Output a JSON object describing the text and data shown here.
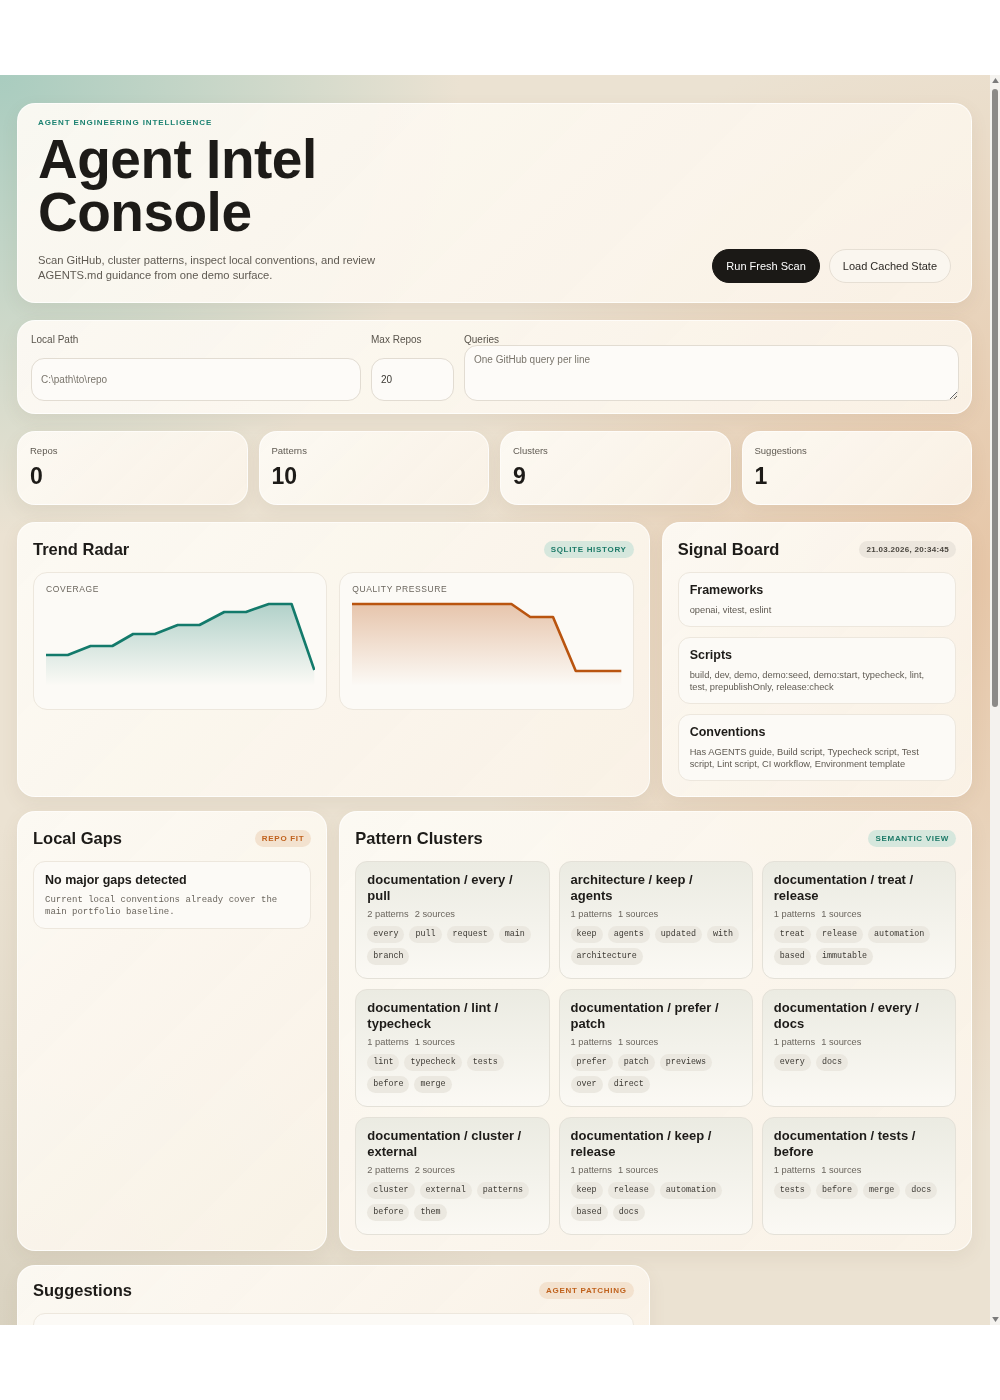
{
  "header": {
    "eyebrow": "AGENT ENGINEERING INTELLIGENCE",
    "title": "Agent Intel Console",
    "subtitle": "Scan GitHub, cluster patterns, inspect local conventions, and review AGENTS.md guidance from one demo surface.",
    "buttons": [
      {
        "label": "Run Fresh Scan",
        "kind": "primary"
      },
      {
        "label": "Load Cached State",
        "kind": "secondary"
      }
    ]
  },
  "form": {
    "fields": [
      {
        "label": "Local Path",
        "kind": "input",
        "placeholder": "C:\\path\\to\\repo"
      },
      {
        "label": "Max Repos",
        "kind": "input",
        "value": "20"
      },
      {
        "label": "Queries",
        "kind": "textarea",
        "placeholder": "One GitHub query per line"
      }
    ]
  },
  "stats": [
    {
      "label": "Repos",
      "value": "0"
    },
    {
      "label": "Patterns",
      "value": "10"
    },
    {
      "label": "Clusters",
      "value": "9"
    },
    {
      "label": "Suggestions",
      "value": "1"
    }
  ],
  "trend_radar": {
    "title": "Trend Radar",
    "badge": {
      "label": "SQLITE HISTORY",
      "kind": "info"
    },
    "charts": [
      {
        "label": "COVERAGE",
        "kind": "coverage"
      },
      {
        "label": "QUALITY PRESSURE",
        "kind": "pressure"
      }
    ]
  },
  "signal_board": {
    "title": "Signal Board",
    "badge": {
      "label": "21.03.2026, 20:34:45",
      "kind": "neutral"
    },
    "items": [
      {
        "title": "Frameworks",
        "text": "openai, vitest, eslint"
      },
      {
        "title": "Scripts",
        "text": "build, dev, demo, demo:seed, demo:start, typecheck, lint, test, prepublishOnly, release:check"
      },
      {
        "title": "Conventions",
        "text": "Has AGENTS guide, Build script, Typecheck script, Test script, Lint script, CI workflow, Environment template"
      }
    ]
  },
  "local_gaps": {
    "title": "Local Gaps",
    "badge": {
      "label": "REPO FIT",
      "kind": "accent"
    },
    "items": [
      {
        "title": "No major gaps detected",
        "text": "Current local conventions already cover the main portfolio baseline."
      }
    ]
  },
  "pattern_clusters": {
    "title": "Pattern Clusters",
    "badge": {
      "label": "SEMANTIC VIEW",
      "kind": "info"
    },
    "clusters": [
      {
        "title": "documentation / every / pull",
        "patterns": "2 patterns",
        "sources": "2 sources",
        "tags": [
          "every",
          "pull",
          "request",
          "main",
          "branch"
        ]
      },
      {
        "title": "architecture / keep / agents",
        "patterns": "1 patterns",
        "sources": "1 sources",
        "tags": [
          "keep",
          "agents",
          "updated",
          "with",
          "architecture"
        ]
      },
      {
        "title": "documentation / treat / release",
        "patterns": "1 patterns",
        "sources": "1 sources",
        "tags": [
          "treat",
          "release",
          "automation",
          "based",
          "immutable"
        ]
      },
      {
        "title": "documentation / lint / typecheck",
        "patterns": "1 patterns",
        "sources": "1 sources",
        "tags": [
          "lint",
          "typecheck",
          "tests",
          "before",
          "merge"
        ]
      },
      {
        "title": "documentation / prefer / patch",
        "patterns": "1 patterns",
        "sources": "1 sources",
        "tags": [
          "prefer",
          "patch",
          "previews",
          "over",
          "direct"
        ]
      },
      {
        "title": "documentation / every / docs",
        "patterns": "1 patterns",
        "sources": "1 sources",
        "tags": [
          "every",
          "docs"
        ]
      },
      {
        "title": "documentation / cluster / external",
        "patterns": "2 patterns",
        "sources": "2 sources",
        "tags": [
          "cluster",
          "external",
          "patterns",
          "before",
          "them"
        ]
      },
      {
        "title": "documentation / keep / release",
        "patterns": "1 patterns",
        "sources": "1 sources",
        "tags": [
          "keep",
          "release",
          "automation",
          "based",
          "docs"
        ]
      },
      {
        "title": "documentation / tests / before",
        "patterns": "1 patterns",
        "sources": "1 sources",
        "tags": [
          "tests",
          "before",
          "merge",
          "docs"
        ]
      }
    ]
  },
  "suggestions": {
    "title": "Suggestions",
    "badge": {
      "label": "AGENT PATCHING",
      "kind": "accent"
    }
  }
}
